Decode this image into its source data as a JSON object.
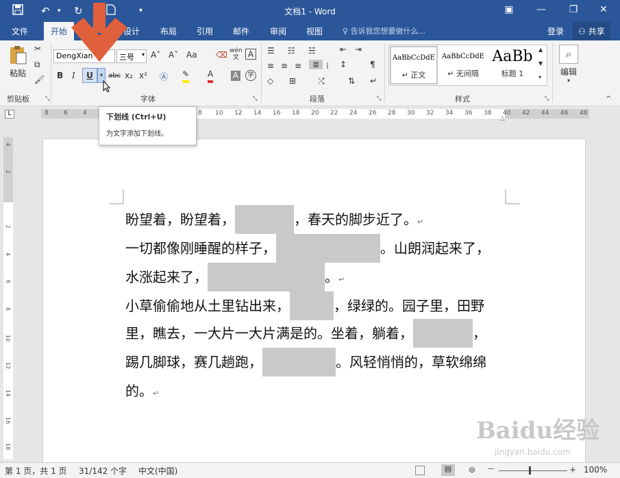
{
  "titlebar": {
    "title": "文档1 - Word",
    "qa": {
      "save_icon": "save-icon",
      "undo": "↶",
      "redo": "↻",
      "newdoc": "new-doc-icon",
      "customize": "▾"
    },
    "win": {
      "options": "▣",
      "min": "—",
      "max": "❐",
      "close": "✕"
    }
  },
  "tabs": [
    {
      "label": "文件"
    },
    {
      "label": "开始"
    },
    {
      "label": "插"
    },
    {
      "label": "设计"
    },
    {
      "label": "布局"
    },
    {
      "label": "引用"
    },
    {
      "label": "邮件"
    },
    {
      "label": "审阅"
    },
    {
      "label": "视图"
    }
  ],
  "tell_me": "告诉我您想要做什么...",
  "login": "登录",
  "share": "共享",
  "ribbon": {
    "clipboard": {
      "paste": "粘贴",
      "group": "剪贴板"
    },
    "font": {
      "name": "DengXian",
      "size": "三号",
      "grow": "A˄",
      "shrink": "A˅",
      "case": "Aa",
      "wen": "wén",
      "wen_char": "文",
      "border_a": "A",
      "bold": "B",
      "italic": "I",
      "underline": "U",
      "strike": "abc",
      "sub": "x₂",
      "sup": "x²",
      "color_a": "A",
      "shade_a": "A",
      "circle": "字",
      "group": "字体"
    },
    "paragraph": {
      "group": "段落"
    },
    "styles": {
      "items": [
        {
          "sample": "AaBbCcDdE",
          "name": "↵ 正文"
        },
        {
          "sample": "AaBbCcDdE",
          "name": "↵ 无间隔"
        },
        {
          "sample": "AaBb",
          "name": "标题 1"
        }
      ],
      "group": "样式"
    },
    "editing": {
      "label": "编辑"
    }
  },
  "ruler_ticks": [
    "8",
    "6",
    "4",
    "2",
    "2",
    "4",
    "6",
    "8",
    "10",
    "12",
    "14",
    "16",
    "18",
    "20",
    "22",
    "24",
    "26",
    "28",
    "30",
    "32",
    "34",
    "36",
    "38",
    "40",
    "42",
    "44",
    "46",
    "48"
  ],
  "vruler_ticks": [
    "4",
    "2",
    "2",
    "4",
    "6",
    "8",
    "10",
    "12",
    "14",
    "16",
    "18"
  ],
  "tooltip": {
    "title": "下划线 (Ctrl+U)",
    "desc": "为文字添加下划线。"
  },
  "document": {
    "lines": [
      {
        "a": "盼望着，盼望着，",
        "b": "，春天的脚步近了。",
        "pm": "↵"
      },
      {
        "a": "一切都像刚睡醒的样子，",
        "b": "。山朗润起来了，",
        "pm": ""
      },
      {
        "a": "水涨起来了，",
        "b": "。",
        "pm": "↵"
      },
      {
        "a": "小草偷偷地从土里钻出来，",
        "b": "，绿绿的。园子里，田野",
        "pm": ""
      },
      {
        "a": "里，瞧去，一大片一大片满是的。坐着，躺着，",
        "b": "，",
        "pm": ""
      },
      {
        "a": "踢几脚球，赛几趟跑，",
        "b": "。风轻悄悄的，草软绵绵",
        "pm": ""
      },
      {
        "a": "的。",
        "b": "",
        "pm": "↵"
      }
    ]
  },
  "status": {
    "page": "第 1 页，共 1 页",
    "words": "31/142 个字",
    "lang": "中文(中国)",
    "zoom": "100%",
    "minus": "—",
    "plus": "+"
  },
  "watermark": {
    "main": "Baidu经验",
    "sub": "jingyan.baidu.com"
  },
  "colors": {
    "accent": "#2b579a",
    "arrow": "#e0603c"
  }
}
